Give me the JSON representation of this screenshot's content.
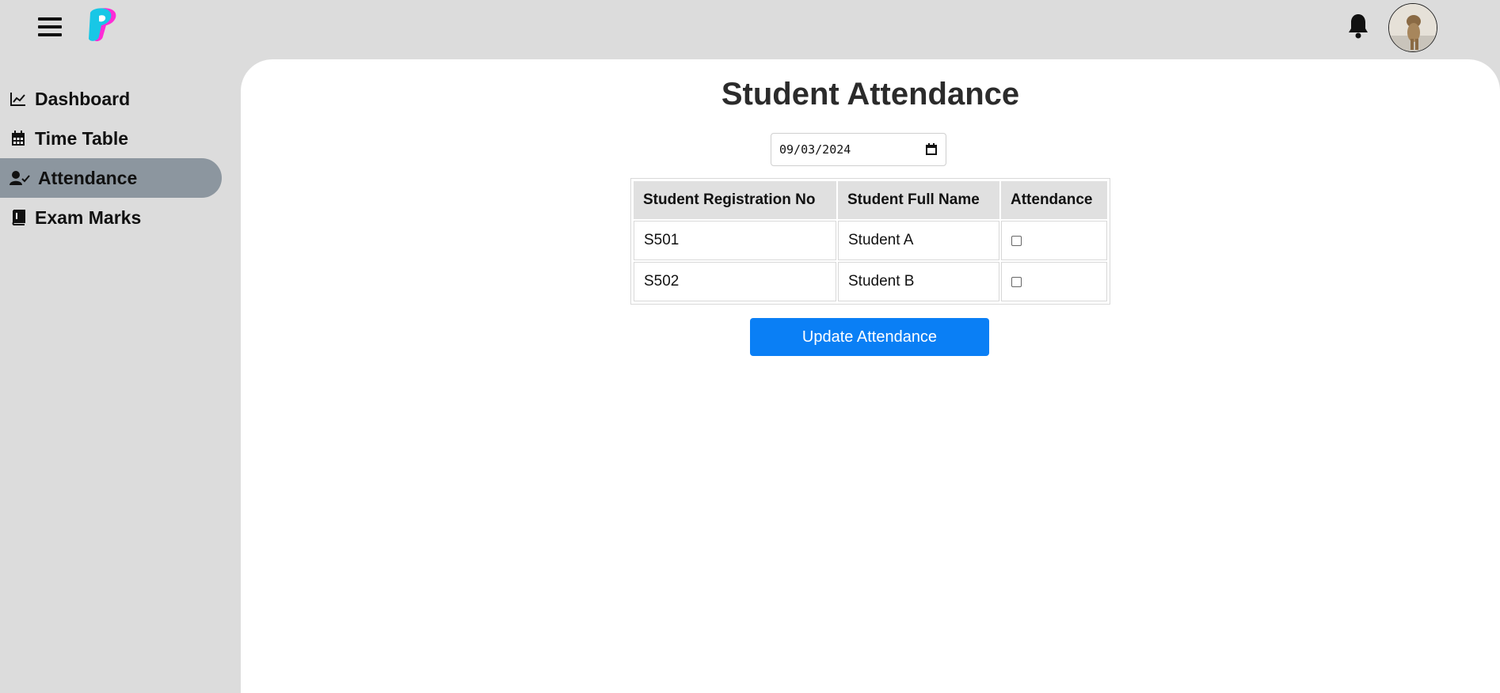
{
  "topbar": {
    "menu_icon": "hamburger-icon",
    "logo_icon": "brand-logo-icon",
    "notification_icon": "bell-icon",
    "avatar_icon": "user-avatar"
  },
  "sidebar": {
    "items": [
      {
        "label": "Dashboard",
        "icon": "chart-line-icon",
        "active": false
      },
      {
        "label": "Time Table",
        "icon": "calendar-icon",
        "active": false
      },
      {
        "label": "Attendance",
        "icon": "user-check-icon",
        "active": true
      },
      {
        "label": "Exam Marks",
        "icon": "book-icon",
        "active": false
      }
    ]
  },
  "main": {
    "title": "Student Attendance",
    "date_value": "09/03/2024",
    "table": {
      "headers": [
        "Student Registration No",
        "Student Full Name",
        "Attendance"
      ],
      "rows": [
        {
          "reg_no": "S501",
          "name": "Student A",
          "present": false
        },
        {
          "reg_no": "S502",
          "name": "Student B",
          "present": false
        }
      ]
    },
    "update_button": "Update Attendance"
  },
  "colors": {
    "background": "#dcdcdc",
    "active_nav": "#8c969f",
    "primary_button": "#0a7ff5",
    "panel": "#ffffff"
  }
}
